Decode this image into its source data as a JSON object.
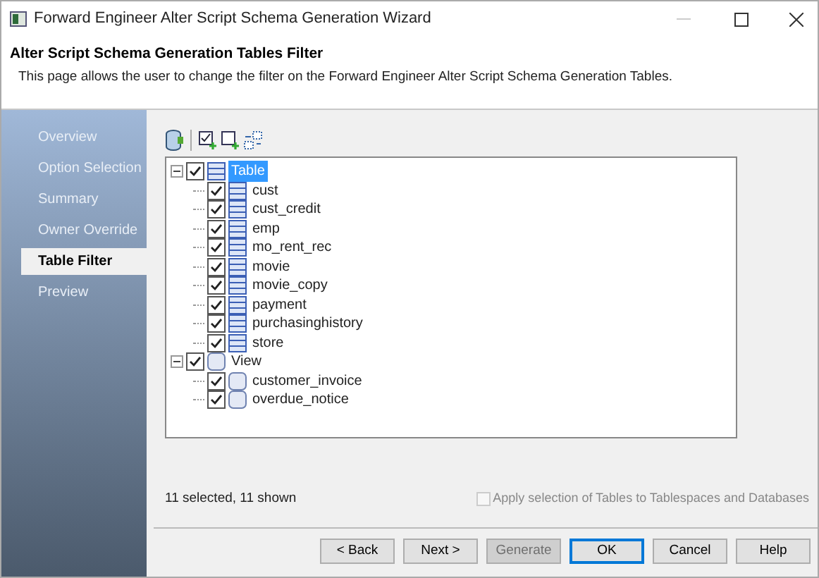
{
  "window": {
    "title": "Forward Engineer Alter Script Schema Generation Wizard"
  },
  "header": {
    "title": "Alter Script Schema Generation Tables Filter",
    "description": "This page allows the user to change the filter on the Forward Engineer Alter Script Schema Generation Tables."
  },
  "sidebar": {
    "items": [
      {
        "label": "Overview",
        "selected": false
      },
      {
        "label": "Option Selection",
        "selected": false
      },
      {
        "label": "Summary",
        "selected": false
      },
      {
        "label": "Owner Override",
        "selected": false
      },
      {
        "label": "Table Filter",
        "selected": true
      },
      {
        "label": "Preview",
        "selected": false
      }
    ]
  },
  "tree": [
    {
      "label": "Table",
      "kind": "table",
      "checked": true,
      "selected": true,
      "expanded": true,
      "children": [
        {
          "label": "cust",
          "kind": "table",
          "checked": true,
          "selected": false
        },
        {
          "label": "cust_credit",
          "kind": "table",
          "checked": true,
          "selected": false
        },
        {
          "label": "emp",
          "kind": "table",
          "checked": true,
          "selected": false
        },
        {
          "label": "mo_rent_rec",
          "kind": "table",
          "checked": true,
          "selected": false
        },
        {
          "label": "movie",
          "kind": "table",
          "checked": true,
          "selected": false
        },
        {
          "label": "movie_copy",
          "kind": "table",
          "checked": true,
          "selected": false
        },
        {
          "label": "payment",
          "kind": "table",
          "checked": true,
          "selected": false
        },
        {
          "label": "purchasinghistory",
          "kind": "table",
          "checked": true,
          "selected": false
        },
        {
          "label": "store",
          "kind": "table",
          "checked": true,
          "selected": false
        }
      ]
    },
    {
      "label": "View",
      "kind": "view",
      "checked": true,
      "selected": false,
      "expanded": true,
      "children": [
        {
          "label": "customer_invoice",
          "kind": "view",
          "checked": true,
          "selected": false
        },
        {
          "label": "overdue_notice",
          "kind": "view",
          "checked": true,
          "selected": false
        }
      ]
    }
  ],
  "status": "11 selected, 11 shown",
  "apply_option": {
    "label": "Apply selection of Tables to Tablespaces and Databases",
    "checked": false,
    "disabled": true
  },
  "buttons": [
    {
      "label": "< Back",
      "disabled": false,
      "default": false
    },
    {
      "label": "Next >",
      "disabled": false,
      "default": false
    },
    {
      "label": "Generate",
      "disabled": true,
      "default": false
    },
    {
      "label": "OK",
      "disabled": false,
      "default": true
    },
    {
      "label": "Cancel",
      "disabled": false,
      "default": false
    },
    {
      "label": "Help",
      "disabled": false,
      "default": false
    }
  ]
}
